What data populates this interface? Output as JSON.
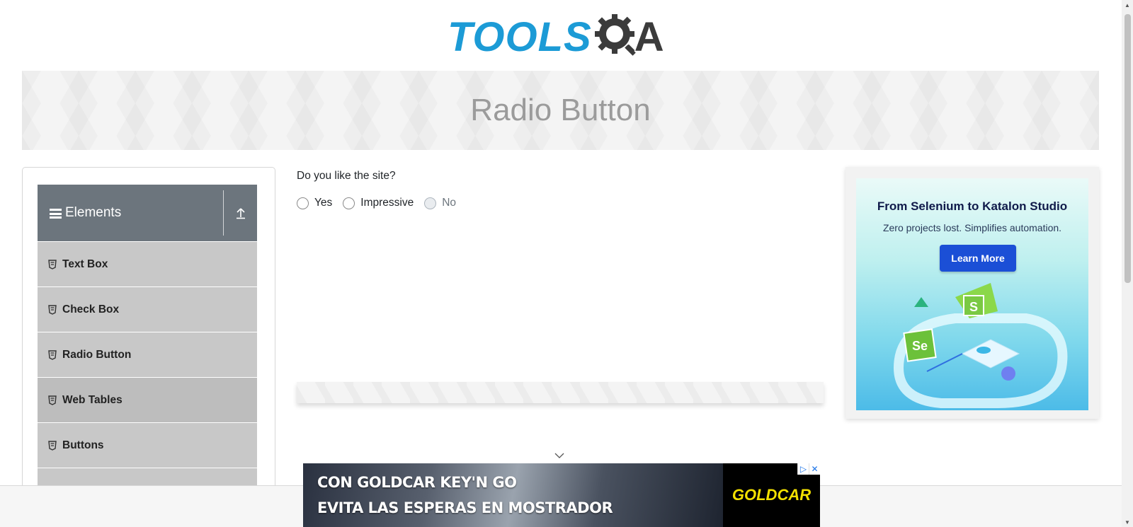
{
  "logo": {
    "word": "TOOLS",
    "letter": "A"
  },
  "banner": {
    "title": "Radio Button"
  },
  "sidebar": {
    "group": {
      "title": "Elements"
    },
    "items": [
      {
        "label": "Text Box"
      },
      {
        "label": "Check Box"
      },
      {
        "label": "Radio Button"
      },
      {
        "label": "Web Tables"
      },
      {
        "label": "Buttons"
      }
    ]
  },
  "main": {
    "question": "Do you like the site?",
    "options": [
      {
        "label": "Yes",
        "disabled": false
      },
      {
        "label": "Impressive",
        "disabled": false
      },
      {
        "label": "No",
        "disabled": true
      }
    ]
  },
  "right_ad": {
    "title": "From Selenium to Katalon Studio",
    "subtitle": "Zero projects lost. Simplifies automation.",
    "button": "Learn More"
  },
  "bottom_ad": {
    "line1": "CON GOLDCAR KEY'N GO",
    "line2": "EVITA LAS ESPERAS EN MOSTRADOR",
    "brand": "GOLDCAR"
  },
  "colors": {
    "brand_blue": "#1c9bd6",
    "sidebar_header": "#6c757d",
    "menu_item": "#c8c8c8",
    "ad_button": "#1b4fd6",
    "brand_yellow": "#f4e100"
  }
}
